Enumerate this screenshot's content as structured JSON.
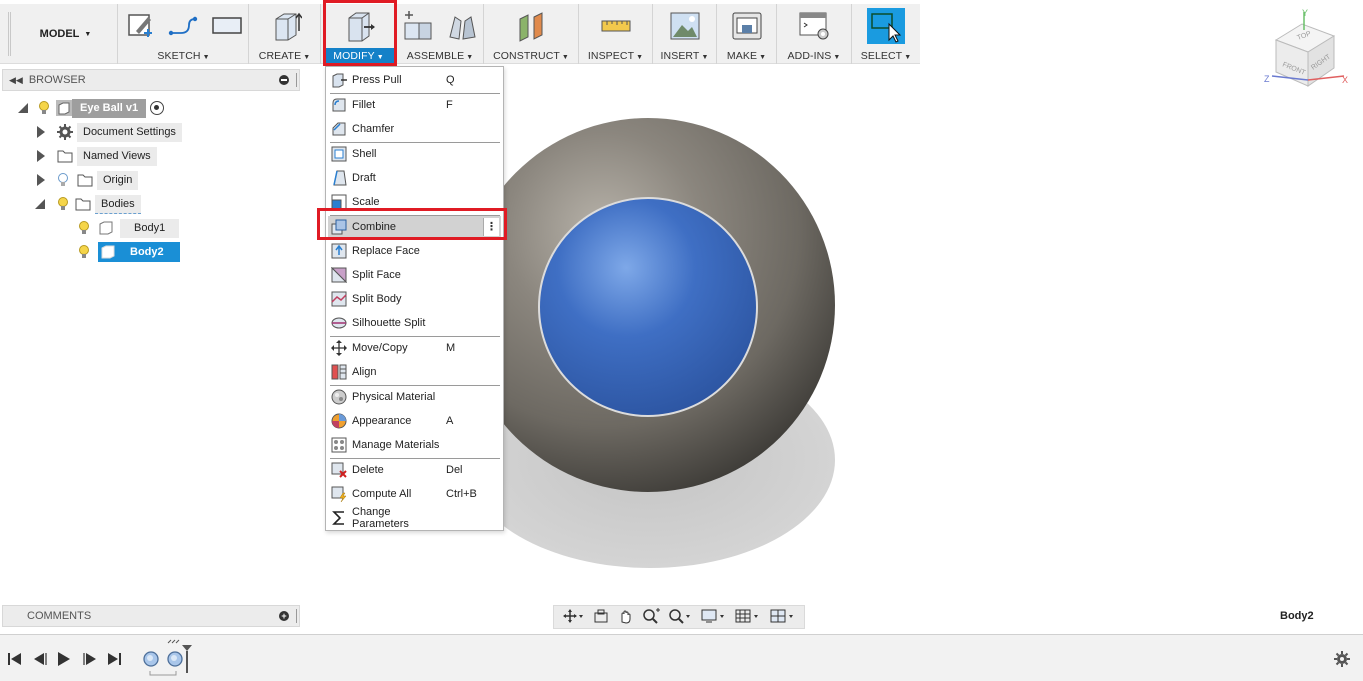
{
  "toolbar": {
    "workspace_label": "MODEL",
    "groups": [
      {
        "label": "SKETCH"
      },
      {
        "label": "CREATE"
      },
      {
        "label": "MODIFY"
      },
      {
        "label": "ASSEMBLE"
      },
      {
        "label": "CONSTRUCT"
      },
      {
        "label": "INSPECT"
      },
      {
        "label": "INSERT"
      },
      {
        "label": "MAKE"
      },
      {
        "label": "ADD-INS"
      },
      {
        "label": "SELECT"
      }
    ]
  },
  "browser": {
    "title": "BROWSER",
    "root": "Eye Ball v1",
    "items": [
      {
        "label": "Document Settings"
      },
      {
        "label": "Named Views"
      },
      {
        "label": "Origin"
      },
      {
        "label": "Bodies"
      },
      {
        "label": "Body1"
      },
      {
        "label": "Body2"
      }
    ]
  },
  "modify_menu": {
    "items": [
      {
        "label": "Press Pull",
        "key": "Q",
        "icon": "press-pull-icon"
      },
      {
        "label": "Fillet",
        "key": "F",
        "icon": "fillet-icon"
      },
      {
        "label": "Chamfer",
        "key": "",
        "icon": "chamfer-icon"
      },
      {
        "label": "Shell",
        "key": "",
        "icon": "shell-icon"
      },
      {
        "label": "Draft",
        "key": "",
        "icon": "draft-icon"
      },
      {
        "label": "Scale",
        "key": "",
        "icon": "scale-icon"
      },
      {
        "label": "Combine",
        "key": "",
        "icon": "combine-icon"
      },
      {
        "label": "Replace Face",
        "key": "",
        "icon": "replace-face-icon"
      },
      {
        "label": "Split Face",
        "key": "",
        "icon": "split-face-icon"
      },
      {
        "label": "Split Body",
        "key": "",
        "icon": "split-body-icon"
      },
      {
        "label": "Silhouette Split",
        "key": "",
        "icon": "silhouette-split-icon"
      },
      {
        "label": "Move/Copy",
        "key": "M",
        "icon": "move-icon"
      },
      {
        "label": "Align",
        "key": "",
        "icon": "align-icon"
      },
      {
        "label": "Physical Material",
        "key": "",
        "icon": "physical-material-icon"
      },
      {
        "label": "Appearance",
        "key": "A",
        "icon": "appearance-icon"
      },
      {
        "label": "Manage Materials",
        "key": "",
        "icon": "manage-materials-icon"
      },
      {
        "label": "Delete",
        "key": "Del",
        "icon": "delete-icon"
      },
      {
        "label": "Compute All",
        "key": "Ctrl+B",
        "icon": "compute-all-icon"
      },
      {
        "label": "Change Parameters",
        "key": "",
        "icon": "sigma-icon"
      }
    ]
  },
  "viewcube": {
    "top": "TOP",
    "front": "FRONT",
    "right": "RIGHT",
    "x": "X",
    "y": "Y",
    "z": "Z"
  },
  "comments": {
    "title": "COMMENTS"
  },
  "status": {
    "selection": "Body2"
  },
  "colors": {
    "accent": "#1481c8",
    "highlight": "#e01b24",
    "iris": "#3f6fc4",
    "ball": "#7a766f"
  }
}
